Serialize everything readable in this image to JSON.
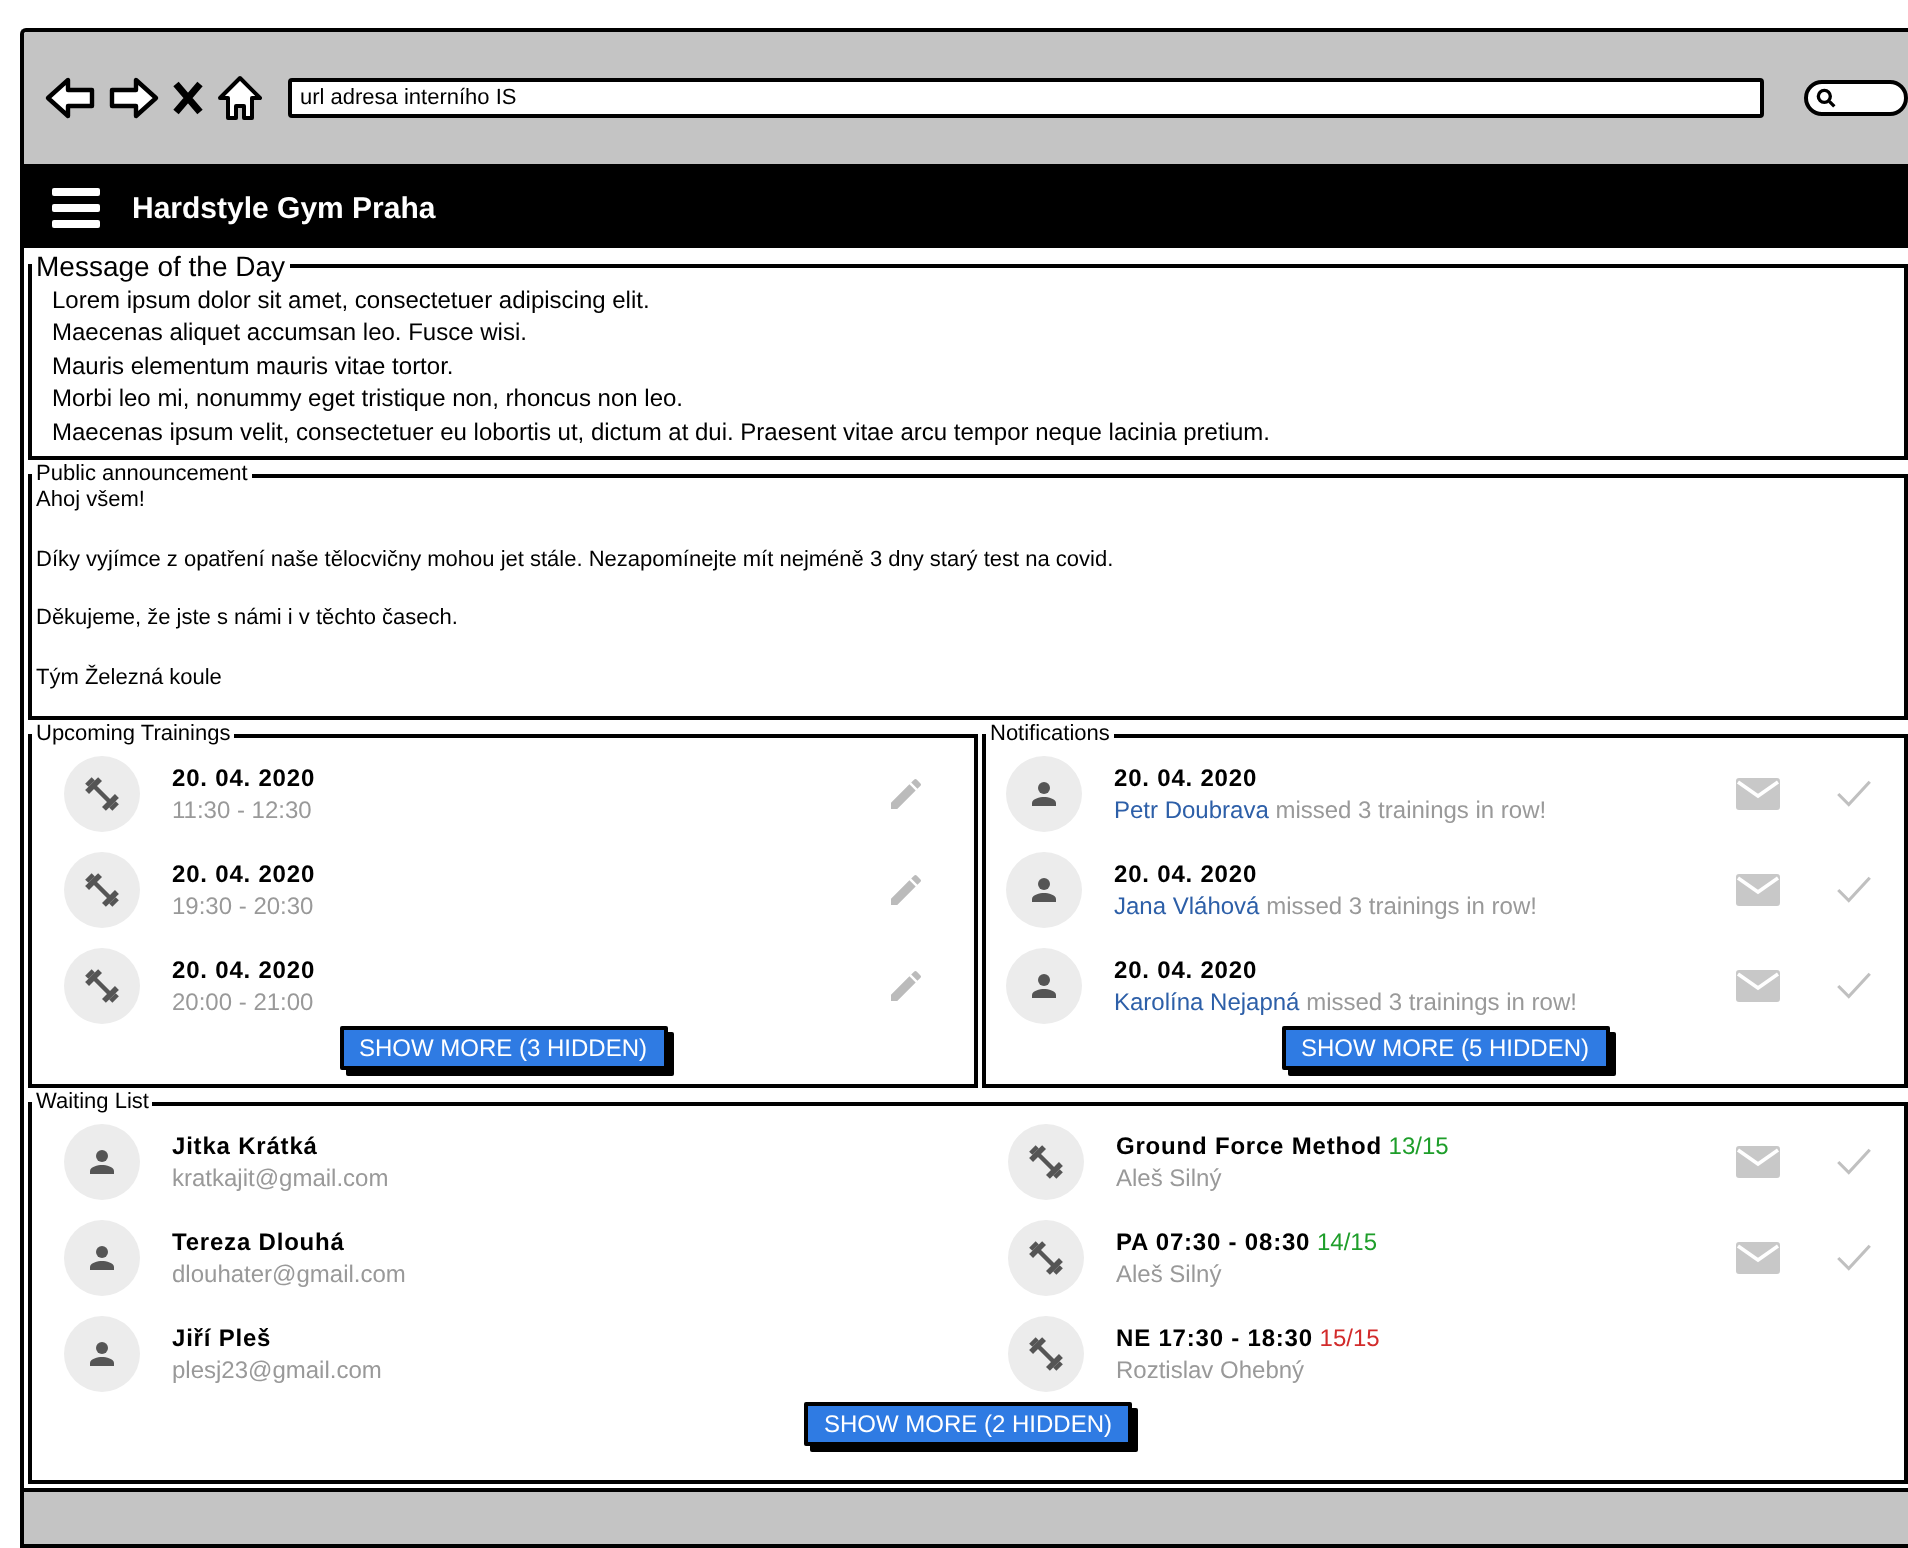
{
  "browser": {
    "url": "url adresa interního IS"
  },
  "header": {
    "title": "Hardstyle Gym Praha"
  },
  "message_of_the_day": {
    "title": "Message of the Day",
    "lines": [
      "Lorem ipsum dolor sit amet, consectetuer adipiscing elit.",
      "Maecenas aliquet accumsan leo. Fusce wisi.",
      "Mauris elementum mauris vitae tortor.",
      "Morbi leo mi, nonummy eget tristique non, rhoncus non leo.",
      "Maecenas ipsum velit, consectetuer eu lobortis ut, dictum at dui. Praesent vitae arcu tempor neque lacinia pretium."
    ]
  },
  "announcement": {
    "title": "Public announcement",
    "paragraphs": [
      "Ahoj všem!",
      "Díky vyjímce z opatření naše tělocvičny mohou jet stále. Nezapomínejte mít nejméně 3 dny starý test na covid.",
      "Děkujeme, že jste s námi i v těchto časech.",
      "Tým Železná koule"
    ]
  },
  "upcoming_trainings": {
    "title": "Upcoming Trainings",
    "items": [
      {
        "date": "20. 04. 2020",
        "time": "11:30 - 12:30"
      },
      {
        "date": "20. 04. 2020",
        "time": "19:30 - 20:30"
      },
      {
        "date": "20. 04. 2020",
        "time": "20:00 - 21:00"
      }
    ],
    "button": "SHOW MORE (3 HIDDEN)"
  },
  "notifications": {
    "title": "Notifications",
    "items": [
      {
        "date": "20. 04. 2020",
        "name": "Petr Doubrava",
        "message": "missed 3 trainings in row!"
      },
      {
        "date": "20. 04. 2020",
        "name": "Jana Vláhová",
        "message": "missed 3 trainings in row!"
      },
      {
        "date": "20. 04. 2020",
        "name": "Karolína Nejapná",
        "message": "missed 3 trainings in row!"
      }
    ],
    "button": "SHOW MORE (5 HIDDEN)"
  },
  "waiting_list": {
    "title": "Waiting List",
    "members": [
      {
        "name": "Jitka Krátká",
        "email": "kratkajit@gmail.com"
      },
      {
        "name": "Tereza Dlouhá",
        "email": "dlouhater@gmail.com"
      },
      {
        "name": "Jiří Pleš",
        "email": "plesj23@gmail.com"
      }
    ],
    "trainings": [
      {
        "title": "Ground Force Method",
        "capacity": "13/15",
        "color": "#1e9e2a",
        "trainer": "Aleš Silný",
        "actions": true
      },
      {
        "title": "PA 07:30 - 08:30",
        "capacity": "14/15",
        "color": "#1e9e2a",
        "trainer": "Aleš Silný",
        "actions": true
      },
      {
        "title": "NE 17:30 - 18:30",
        "capacity": "15/15",
        "color": "#d22b2b",
        "trainer": "Roztislav Ohebný",
        "actions": false
      }
    ],
    "button": "SHOW MORE (2 HIDDEN)"
  }
}
